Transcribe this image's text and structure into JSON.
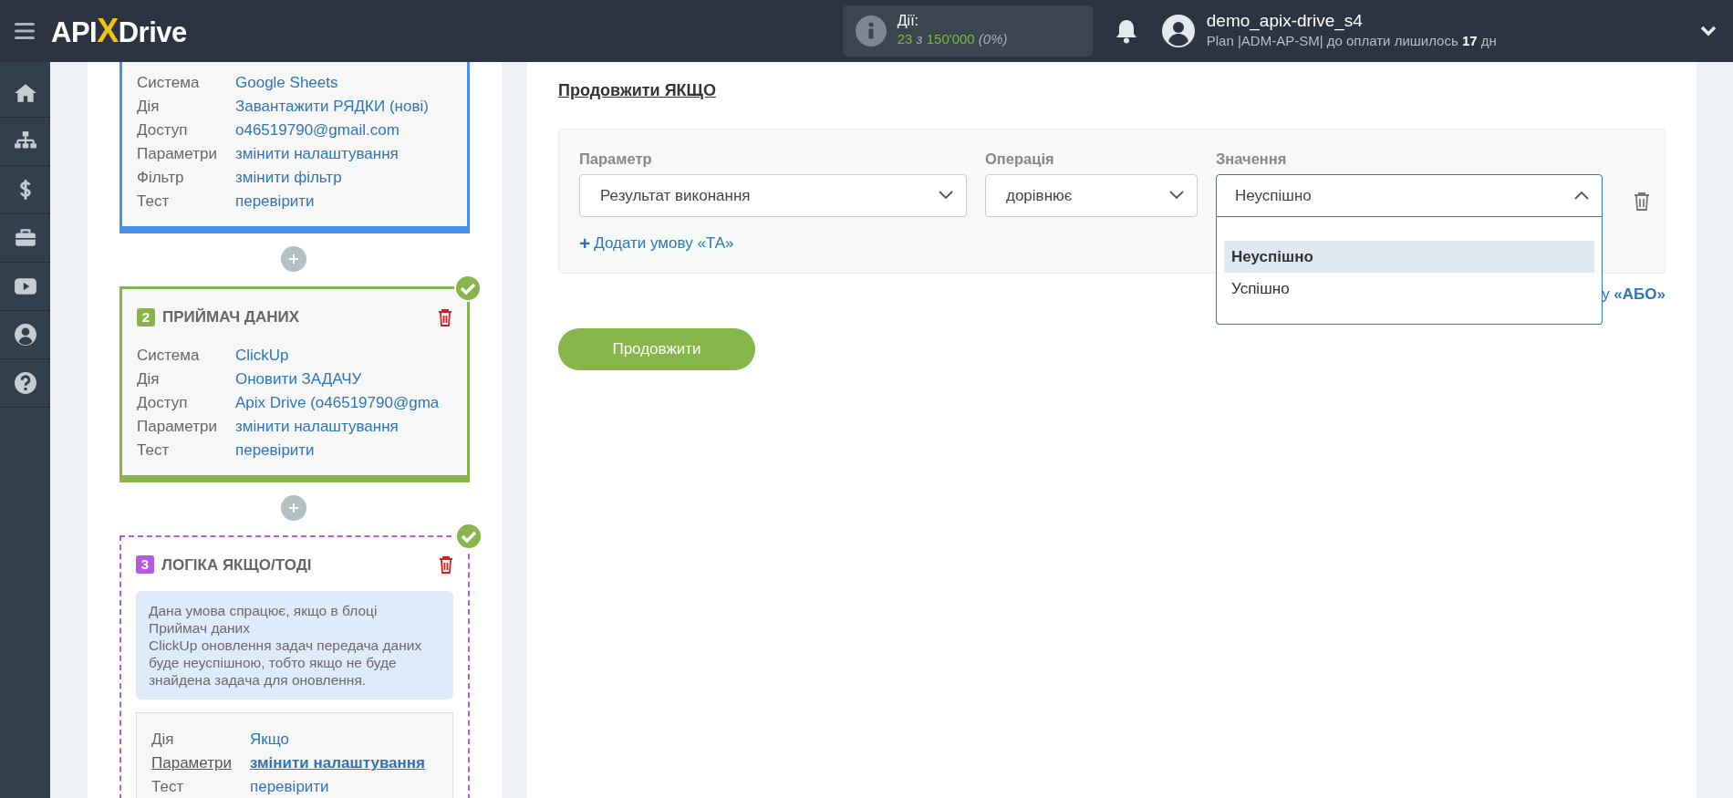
{
  "header": {
    "logo": {
      "left": "API",
      "mark": "X",
      "right": "Drive"
    },
    "actions": {
      "label": "Дії:",
      "used": "23",
      "sep": "з",
      "limit": "150'000",
      "percent": "(0%)"
    },
    "user": {
      "name": "demo_apix-drive_s4",
      "plan": "Plan |ADM-AP-SM| до оплати лишилось **17** дн"
    }
  },
  "sidebar": {
    "items": [
      {
        "kind": "home"
      },
      {
        "kind": "sitemap"
      },
      {
        "kind": "dollar"
      },
      {
        "kind": "briefcase"
      },
      {
        "kind": "video"
      },
      {
        "kind": "user"
      },
      {
        "kind": "help"
      }
    ]
  },
  "blocks": [
    {
      "kind": "source",
      "rows": [
        {
          "label": "Система",
          "value": "Google Sheets",
          "selected": false
        },
        {
          "label": "Дія",
          "value": "Завантажити РЯДКИ (нові)",
          "selected": false
        },
        {
          "label": "Доступ",
          "value": "o46519790@gmail.com",
          "selected": false
        },
        {
          "label": "Параметри",
          "value": "змінити налаштування",
          "selected": false
        },
        {
          "label": "Фільтр",
          "value": "змінити фільтр",
          "selected": false
        },
        {
          "label": "Тест",
          "value": "перевірити",
          "selected": false
        }
      ]
    },
    {
      "kind": "target",
      "number": "2",
      "title": "ПРИЙМАЧ ДАНИХ",
      "done": true,
      "rows": [
        {
          "label": "Система",
          "value": "ClickUp",
          "selected": false
        },
        {
          "label": "Дія",
          "value": "Оновити ЗАДАЧУ",
          "selected": false
        },
        {
          "label": "Доступ",
          "value": "Apix Drive (o46519790@gma",
          "selected": false
        },
        {
          "label": "Параметри",
          "value": "змінити налаштування",
          "selected": false
        },
        {
          "label": "Тест",
          "value": "перевірити",
          "selected": false
        }
      ]
    },
    {
      "kind": "logic",
      "number": "3",
      "title": "ЛОГІКА ЯКЩО/ТОДІ",
      "done": true,
      "note": [
        "Дана умова спрацює, якщо в блоці",
        "Приймач даних",
        "ClickUp оновлення задач передача даних буде неуспішною, тобто якщо не буде знайдена задача для оновлення."
      ],
      "rows": [
        {
          "label": "Дія",
          "value": "Якщо",
          "selected": false
        },
        {
          "label": "Параметри",
          "value": "змінити налаштування",
          "selected": true
        },
        {
          "label": "Тест",
          "value": "перевірити",
          "selected": false
        }
      ]
    }
  ],
  "main": {
    "title": "Продовжити ЯКЩО",
    "condition": {
      "parameter": {
        "label": "Параметр",
        "value": "Результат виконання"
      },
      "operation": {
        "label": "Операція",
        "value": "дорівнює"
      },
      "value": {
        "label": "Значення",
        "value": "Неуспішно",
        "expanded": true,
        "options": [
          {
            "label": "Неуспішно",
            "selected": true
          },
          {
            "label": "Успішно",
            "selected": false
          }
        ]
      },
      "add_and": {
        "icon": "+",
        "label": "Додати умову «ТА»"
      }
    },
    "add_or": "у **«АБО»**",
    "continue_button": "Продовжити"
  }
}
